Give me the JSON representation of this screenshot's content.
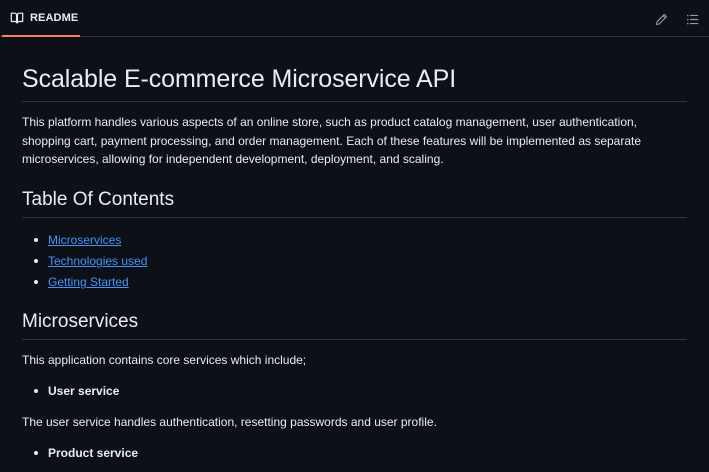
{
  "header": {
    "tab_label": "README",
    "tab_icon": "book-icon",
    "edit_icon": "pencil-icon",
    "outline_icon": "list-icon",
    "accent_color": "#f78166"
  },
  "readme": {
    "title": "Scalable E-commerce Microservice API",
    "intro": "This platform handles various aspects of an online store, such as product catalog management, user authentication, shopping cart, payment processing, and order management. Each of these features will be implemented as separate microservices, allowing for independent development, deployment, and scaling.",
    "toc_heading": "Table Of Contents",
    "toc": [
      {
        "label": "Microservices"
      },
      {
        "label": "Technologies used"
      },
      {
        "label": "Getting Started"
      }
    ],
    "microservices_heading": "Microservices",
    "microservices_intro": "This application contains core services which include;",
    "user_service": {
      "name": "User service",
      "description": "The user service handles authentication, resetting passwords and user profile."
    },
    "product_service": {
      "name": "Product service"
    }
  },
  "colors": {
    "background": "#0d1117",
    "text": "#e6edf3",
    "link": "#4493f8",
    "border": "#30363d"
  }
}
